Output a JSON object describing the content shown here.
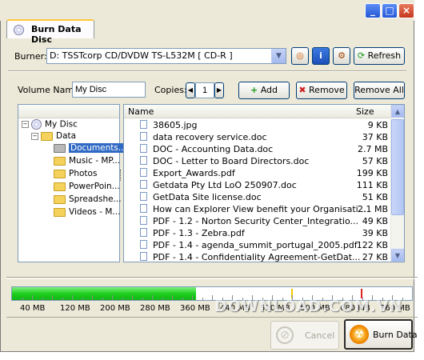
{
  "window": {
    "title_buttons": {
      "minimize": "_",
      "maximize": "□",
      "close": "×"
    }
  },
  "tab": {
    "label": "Burn Data Disc",
    "icon": "disc-icon"
  },
  "burner": {
    "label": "Burner:",
    "value": "D: TSSTcorp CD/DVDW TS-L532M [ CD-R ]",
    "refresh_label": "Refresh"
  },
  "volume": {
    "label": "Volume Name:",
    "value": "My Disc"
  },
  "copies": {
    "label": "Copies:",
    "value": "1"
  },
  "buttons": {
    "add": "Add",
    "remove": "Remove",
    "remove_all": "Remove All",
    "cancel": "Cancel",
    "burn": "Burn Data"
  },
  "tree": {
    "root": "My Disc",
    "data": "Data",
    "items": [
      "Documents...",
      "Music - MP...",
      "Photos",
      "PowerPoin...",
      "Spreadshe...",
      "Videos - M..."
    ]
  },
  "files": {
    "columns": {
      "name": "Name",
      "size": "Size"
    },
    "rows": [
      {
        "name": "38605.jpg",
        "size": "9 KB"
      },
      {
        "name": "data recovery service.doc",
        "size": "37 KB"
      },
      {
        "name": "DOC - Accounting Data.doc",
        "size": "2.7 MB"
      },
      {
        "name": "DOC - Letter to Board Directors.doc",
        "size": "57 KB"
      },
      {
        "name": "Export_Awards.pdf",
        "size": "199 KB"
      },
      {
        "name": "Getdata Pty Ltd LoO 250907.doc",
        "size": "111 KB"
      },
      {
        "name": "GetData Site license.doc",
        "size": "51 KB"
      },
      {
        "name": "How can Explorer View benefit your Organisati...",
        "size": "2.1 MB"
      },
      {
        "name": "PDF - 1.2 - Norton Security Center_Integratio...",
        "size": "49 KB"
      },
      {
        "name": "PDF - 1.3 - Zebra.pdf",
        "size": "39 KB"
      },
      {
        "name": "PDF - 1.4 - agenda_summit_portugal_2005.pdf",
        "size": "122 KB"
      },
      {
        "name": "PDF - 1.4 - Confidentiality Agreement-GetDat...",
        "size": "27 KB"
      }
    ]
  },
  "capacity": {
    "used_mb": 368,
    "labels": [
      "40 MB",
      "120 MB",
      "200 MB",
      "280 MB",
      "360 MB",
      "440 MB",
      "520 MB",
      "600 MB",
      "680 MB",
      "760 MB"
    ],
    "colors": {
      "fill": "#1fd01f",
      "marker_yellow": "#f0c800",
      "marker_red": "#e02020"
    }
  },
  "watermark": "DOWNLOAD.COM.VN"
}
